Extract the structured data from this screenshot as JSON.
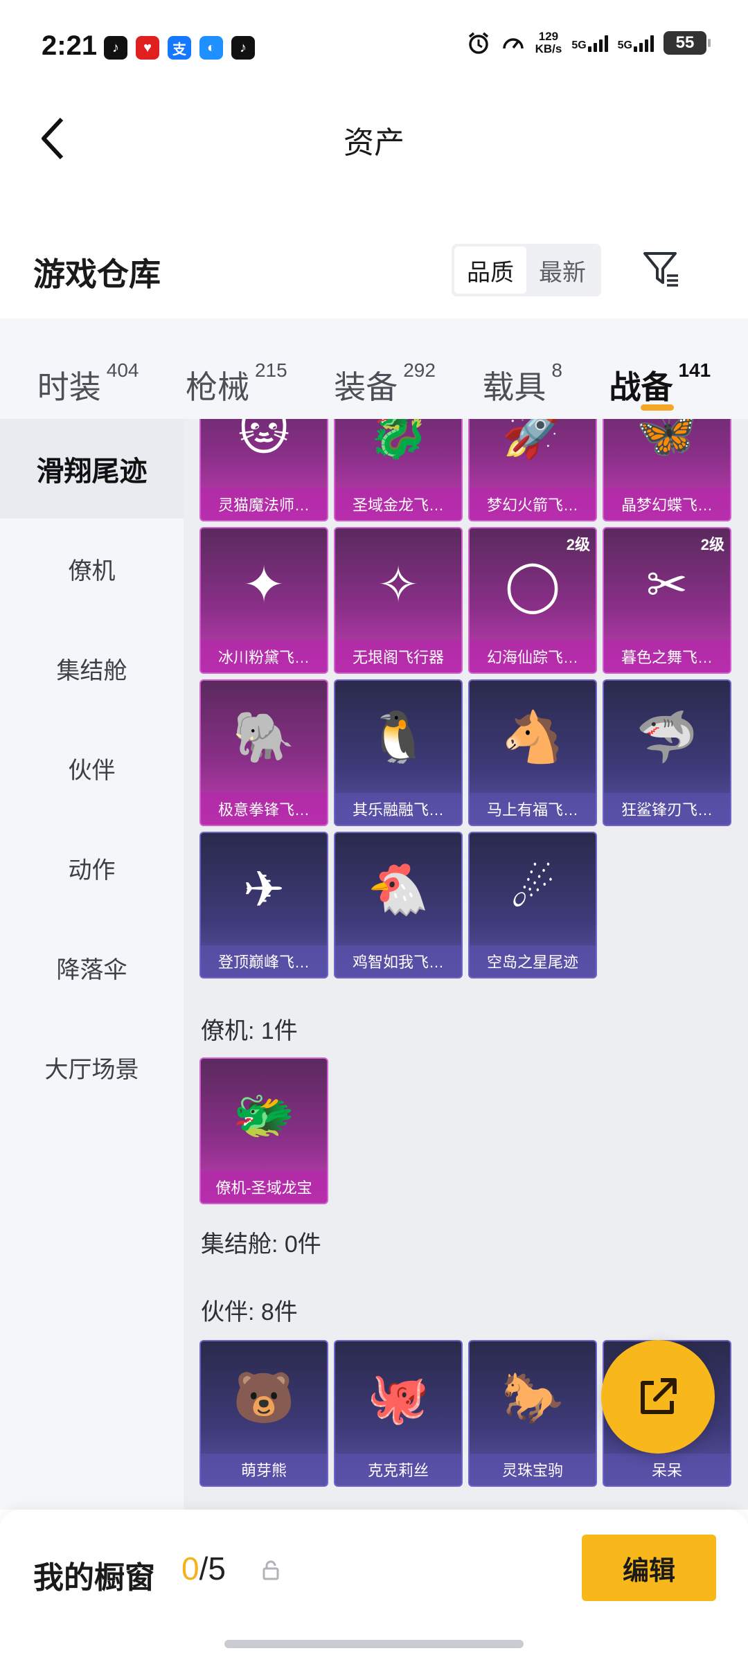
{
  "status_bar": {
    "time": "2:21",
    "net_speed_value": "129",
    "net_speed_unit": "KB/s",
    "sim1": "5G",
    "sim2": "5G",
    "battery": "55"
  },
  "header": {
    "title": "资产"
  },
  "section": {
    "title": "游戏仓库",
    "sort_options": [
      "品质",
      "最新"
    ],
    "sort_selected": "品质"
  },
  "tabs": [
    {
      "label": "时装",
      "count": "404"
    },
    {
      "label": "枪械",
      "count": "215"
    },
    {
      "label": "装备",
      "count": "292"
    },
    {
      "label": "载具",
      "count": "8"
    },
    {
      "label": "战备",
      "count": "141",
      "active": true
    }
  ],
  "sidebar": {
    "items": [
      {
        "label": "滑翔尾迹",
        "active": true
      },
      {
        "label": "僚机"
      },
      {
        "label": "集结舱"
      },
      {
        "label": "伙伴"
      },
      {
        "label": "动作"
      },
      {
        "label": "降落伞"
      },
      {
        "label": "大厅场景"
      }
    ]
  },
  "groups": {
    "glide": {
      "items": [
        {
          "name": "灵猫魔法师…",
          "rarity": "purple",
          "icon": "cat-icon"
        },
        {
          "name": "圣域金龙飞…",
          "rarity": "purple",
          "icon": "dragon-icon"
        },
        {
          "name": "梦幻火箭飞…",
          "rarity": "purple",
          "icon": "rocket-icon"
        },
        {
          "name": "晶梦幻蝶飞…",
          "rarity": "purple",
          "icon": "butterfly-icon"
        },
        {
          "name": "冰川粉黛飞…",
          "rarity": "purple",
          "icon": "wand-icon"
        },
        {
          "name": "无垠阁飞行器",
          "rarity": "purple",
          "icon": "compass-icon"
        },
        {
          "name": "幻海仙踪飞…",
          "rarity": "purple",
          "level": "2级",
          "icon": "bubble-icon"
        },
        {
          "name": "暮色之舞飞…",
          "rarity": "purple",
          "level": "2级",
          "icon": "blades-icon"
        },
        {
          "name": "极意拳锋飞…",
          "rarity": "purple",
          "icon": "elephant-icon"
        },
        {
          "name": "其乐融融飞…",
          "rarity": "blue",
          "icon": "penguin-icon"
        },
        {
          "name": "马上有福飞…",
          "rarity": "blue",
          "icon": "horse-icon"
        },
        {
          "name": "狂鲨锋刃飞…",
          "rarity": "blue",
          "icon": "shark-icon"
        },
        {
          "name": "登顶巅峰飞…",
          "rarity": "blue",
          "icon": "jet-icon"
        },
        {
          "name": "鸡智如我飞…",
          "rarity": "blue",
          "icon": "chicken-icon"
        },
        {
          "name": "空岛之星尾迹",
          "rarity": "blue",
          "icon": "rainbow-trail-icon"
        }
      ]
    },
    "wingman": {
      "title": "僚机: 1件",
      "items": [
        {
          "name": "僚机-圣域龙宝",
          "rarity": "purple",
          "icon": "baby-dragon-icon"
        }
      ]
    },
    "capsule": {
      "title": "集结舱: 0件"
    },
    "partner": {
      "title": "伙伴: 8件",
      "items": [
        {
          "name": "萌芽熊",
          "rarity": "blue",
          "icon": "bear-icon"
        },
        {
          "name": "克克莉丝",
          "rarity": "blue",
          "icon": "octopus-icon"
        },
        {
          "name": "灵珠宝驹",
          "rarity": "blue",
          "icon": "pony-icon"
        },
        {
          "name": "呆呆",
          "rarity": "blue",
          "icon": "blob-icon"
        }
      ]
    }
  },
  "bottom": {
    "showcase_label": "我的橱窗",
    "showcase_current": "0",
    "showcase_total": "/5",
    "edit_label": "编辑"
  },
  "colors": {
    "accent": "#f8b81c",
    "purple_card": "#8a2f88",
    "blue_card": "#3e3a78"
  }
}
